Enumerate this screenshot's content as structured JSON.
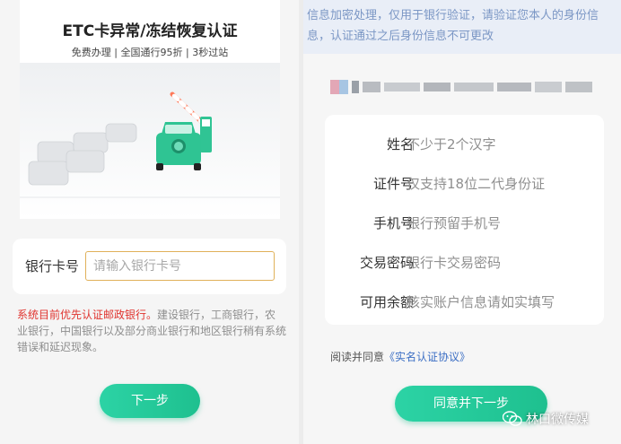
{
  "left": {
    "banner": {
      "title": "ETC卡异常/冻结恢复认证",
      "subtitle": "免费办理 | 全国通行95折 | 3秒过站"
    },
    "card_input": {
      "label": "银行卡号",
      "placeholder": "请输入银行卡号"
    },
    "notice": {
      "highlight": "系统目前优先认证邮政银行。",
      "rest": "建设银行，工商银行，农业银行，中国银行以及部分商业银行和地区银行稍有系统错误和延迟现象。"
    },
    "next_button": "下一步"
  },
  "right": {
    "top_note": "信息加密处理，仅用于银行验证，请验证您本人的身份信息，认证通过之后身份信息不可更改",
    "form": [
      {
        "label": "姓名",
        "hint": "不少于2个汉字"
      },
      {
        "label": "证件号",
        "hint": "仅支持18位二代身份证"
      },
      {
        "label": "手机号",
        "hint": "银行预留手机号"
      },
      {
        "label": "交易密码",
        "hint": "银行卡交易密码"
      },
      {
        "label": "可用余额",
        "hint": "核实账户信息请如实填写"
      }
    ],
    "agreement": {
      "prefix": "阅读并同意",
      "link": "《实名认证协议》"
    },
    "agree_next_button": "同意并下一步"
  },
  "watermark": "林口微传媒",
  "colors": {
    "accent": "#22c99a",
    "warning": "#e0342f",
    "link": "#3c6fc4",
    "note_bg": "#e9eef7",
    "note_text": "#7b97c5"
  }
}
